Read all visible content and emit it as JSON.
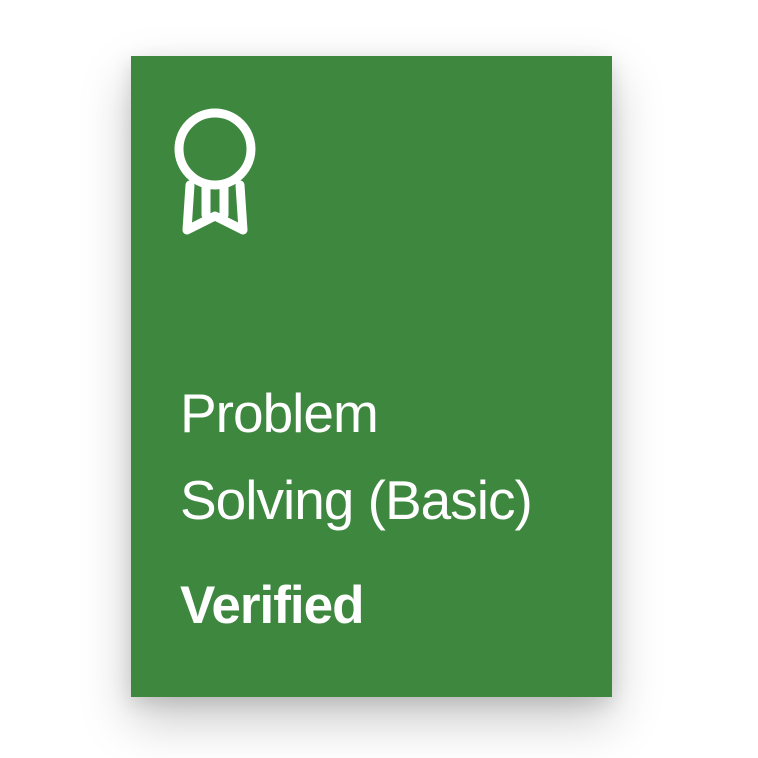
{
  "badge": {
    "icon": "award-ribbon-icon",
    "title_line1": "Problem",
    "title_line2": "Solving (Basic)",
    "status": "Verified",
    "background_color": "#3e873f",
    "text_color": "#ffffff"
  }
}
